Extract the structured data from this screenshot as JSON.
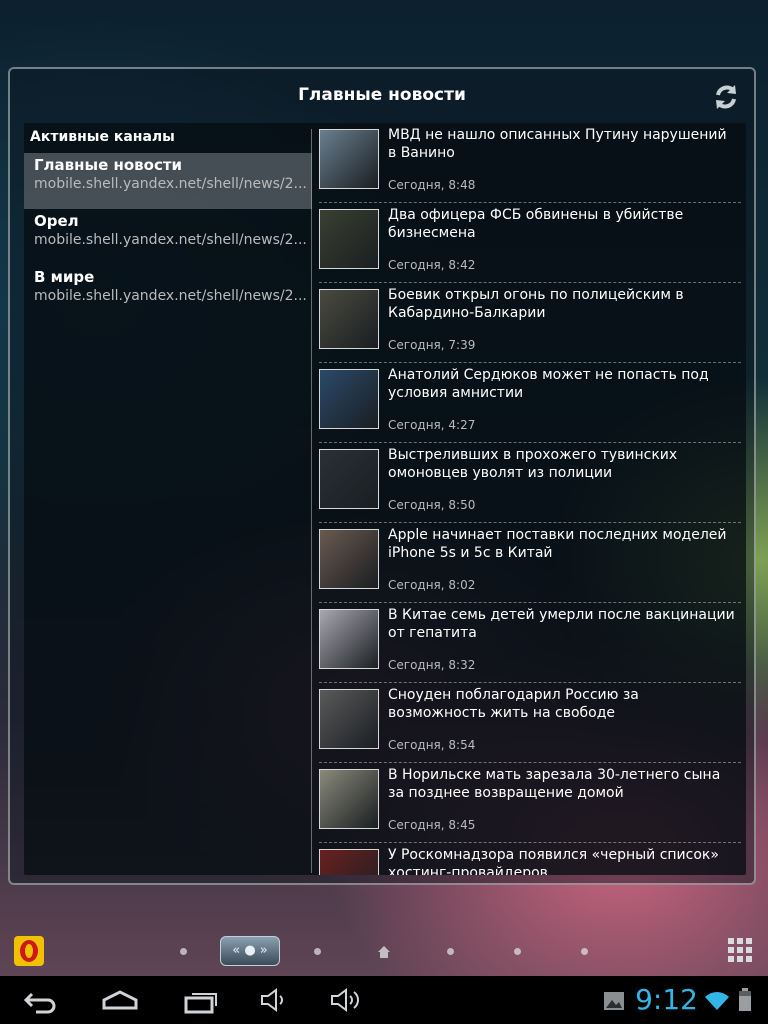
{
  "widget": {
    "title": "Главные новости"
  },
  "channels": {
    "header": "Активные каналы",
    "items": [
      {
        "name": "Главные новости",
        "url": "mobile.shell.yandex.net/shell/news/2..."
      },
      {
        "name": "Орел",
        "url": "mobile.shell.yandex.net/shell/news/2..."
      },
      {
        "name": "В мире",
        "url": "mobile.shell.yandex.net/shell/news/2..."
      }
    ]
  },
  "news": [
    {
      "title": "МВД не нашло описанных Путину нарушений в Ванино",
      "time": "Сегодня, 8:48",
      "thumb_color": "#6a7f8f"
    },
    {
      "title": "Два офицера ФСБ обвинены в убийстве бизнесмена",
      "time": "Сегодня, 8:42",
      "thumb_color": "#3a4030"
    },
    {
      "title": "Боевик открыл огонь по полицейским в Кабардино-Балкарии",
      "time": "Сегодня, 7:39",
      "thumb_color": "#4a4a40"
    },
    {
      "title": "Анатолий Сердюков может не попасть под условия амнистии",
      "time": "Сегодня, 4:27",
      "thumb_color": "#2a4a6a"
    },
    {
      "title": "Выстреливших в прохожего тувинских омоновцев уволят из полиции",
      "time": "Сегодня, 8:50",
      "thumb_color": "#2a3036"
    },
    {
      "title": "Apple начинает поставки последних моделей iPhone 5s и 5c в Китай",
      "time": "Сегодня, 8:02",
      "thumb_color": "#6a5a50"
    },
    {
      "title": "В Китае семь детей умерли после вакцинации от гепатита",
      "time": "Сегодня, 8:32",
      "thumb_color": "#a8a8b0"
    },
    {
      "title": "Сноуден поблагодарил Россию за возможность жить на свободе",
      "time": "Сегодня, 8:54",
      "thumb_color": "#5a5a5a"
    },
    {
      "title": "В Норильске мать зарезала 30-летнего сына за позднее возвращение домой",
      "time": "Сегодня, 8:45",
      "thumb_color": "#8a8a7a"
    },
    {
      "title": "У Роскомнадзора появился «черный список» хостинг-провайдеров",
      "time": "",
      "thumb_color": "#6a2020"
    }
  ],
  "dock": {
    "opera_letter": "O"
  },
  "statusbar": {
    "time": "9:12"
  },
  "colors": {
    "clock": "#33b5e5",
    "accent_opera": "#f2c200"
  }
}
